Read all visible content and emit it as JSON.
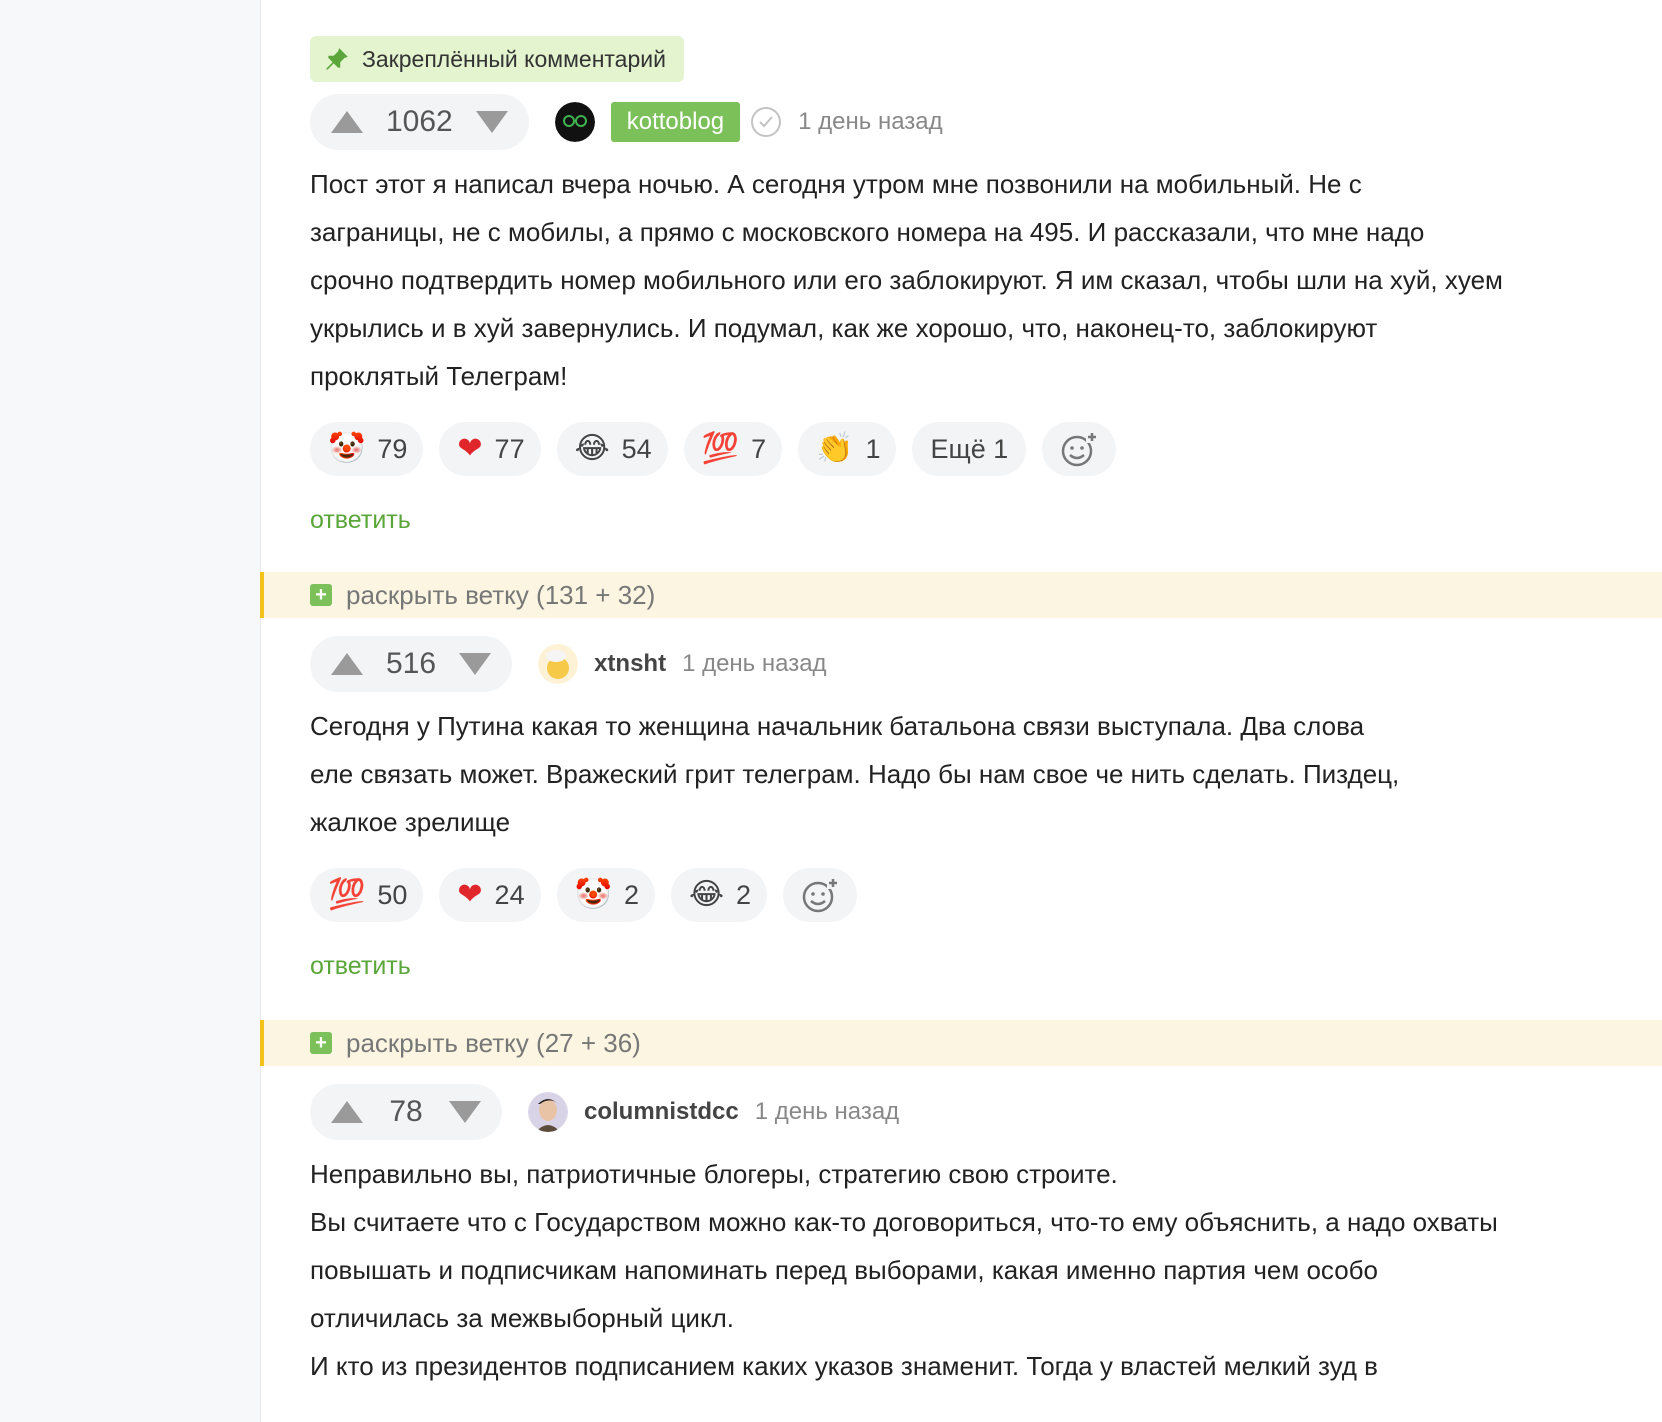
{
  "pinned": {
    "label": "Закреплённый комментарий"
  },
  "comments": [
    {
      "score": "1062",
      "username": "kottoblog",
      "time": "1 день назад",
      "text": "Пост этот я написал вчера ночью. А сегодня утром мне позвонили на мобильный. Не с\nзаграницы, не с мобилы, а прямо с московского номера на 495. И рассказали, что мне надо\nсрочно подтвердить номер мобильного или его заблокируют. Я им сказал, чтобы шли на хуй, хуем\nукрылись и в хуй завернулись. И подумал, как же хорошо, что, наконец-то, заблокируют\nпроклятый Телеграм!",
      "reactions": [
        {
          "icon": "clown-face-icon",
          "emoji": "🤡",
          "count": "79"
        },
        {
          "icon": "red-heart-icon",
          "emoji": "❤",
          "count": "77"
        },
        {
          "icon": "laughing-face-icon",
          "emoji": "😂",
          "count": "54"
        },
        {
          "icon": "hundred-points-icon",
          "emoji": "💯",
          "count": "7"
        },
        {
          "icon": "clapping-hands-icon",
          "emoji": "👏",
          "count": "1"
        }
      ],
      "more_label": "Ещё 1",
      "reply_label": "ответить"
    },
    {
      "score": "516",
      "username": "xtnsht",
      "time": "1 день назад",
      "text": "Сегодня у Путина какая то женщина начальник батальона связи выступала. Два слова\nеле связать может. Вражеский грит телеграм. Надо бы нам свое че нить сделать. Пиздец,\nжалкое зрелище",
      "reactions": [
        {
          "icon": "hundred-points-icon",
          "emoji": "💯",
          "count": "50"
        },
        {
          "icon": "red-heart-icon",
          "emoji": "❤",
          "count": "24"
        },
        {
          "icon": "clown-face-icon",
          "emoji": "🤡",
          "count": "2"
        },
        {
          "icon": "laughing-face-icon",
          "emoji": "😂",
          "count": "2"
        }
      ],
      "reply_label": "ответить"
    },
    {
      "score": "78",
      "username": "columnistdcc",
      "time": "1 день назад",
      "text": "Неправильно вы, патриотичные блогеры, стратегию свою строите.\nВы считаете что с Государством можно как-то договориться, что-то ему объяснить, а надо охваты\nповышать и подписчикам напоминать перед выборами, какая именно партия чем особо\nотличилась за межвыборный цикл.\nИ кто из президентов подписанием каких указов знаменит. Тогда у властей мелкий зуд в"
    }
  ],
  "branches": [
    {
      "label": "раскрыть ветку (131 + 32)"
    },
    {
      "label": "раскрыть ветку (27 + 36)"
    }
  ],
  "colors": {
    "accent": "#7cc05a",
    "reply": "#5aa63a",
    "branch_bg": "#fcf5e1",
    "branch_border": "#f2c21b"
  }
}
